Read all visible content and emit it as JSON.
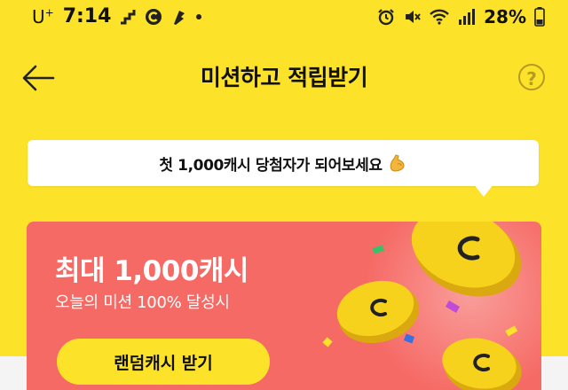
{
  "status_bar": {
    "carrier": "U",
    "carrier_sup": "+",
    "time": "7:14",
    "battery_pct": "28%"
  },
  "header": {
    "title": "미션하고 적립받기",
    "help_label": "?"
  },
  "tooltip": {
    "text": "첫 1,000캐시 당첨자가 되어보세요"
  },
  "promo": {
    "title": "최대 1,000캐시",
    "subtitle": "오늘의 미션 100% 달성시",
    "button_label": "랜덤캐시 받기",
    "coin_mark": "C"
  },
  "colors": {
    "background": "#FDE22A",
    "card": "#F66A65",
    "button": "#FDE22A",
    "coin": "#F7D21C"
  }
}
